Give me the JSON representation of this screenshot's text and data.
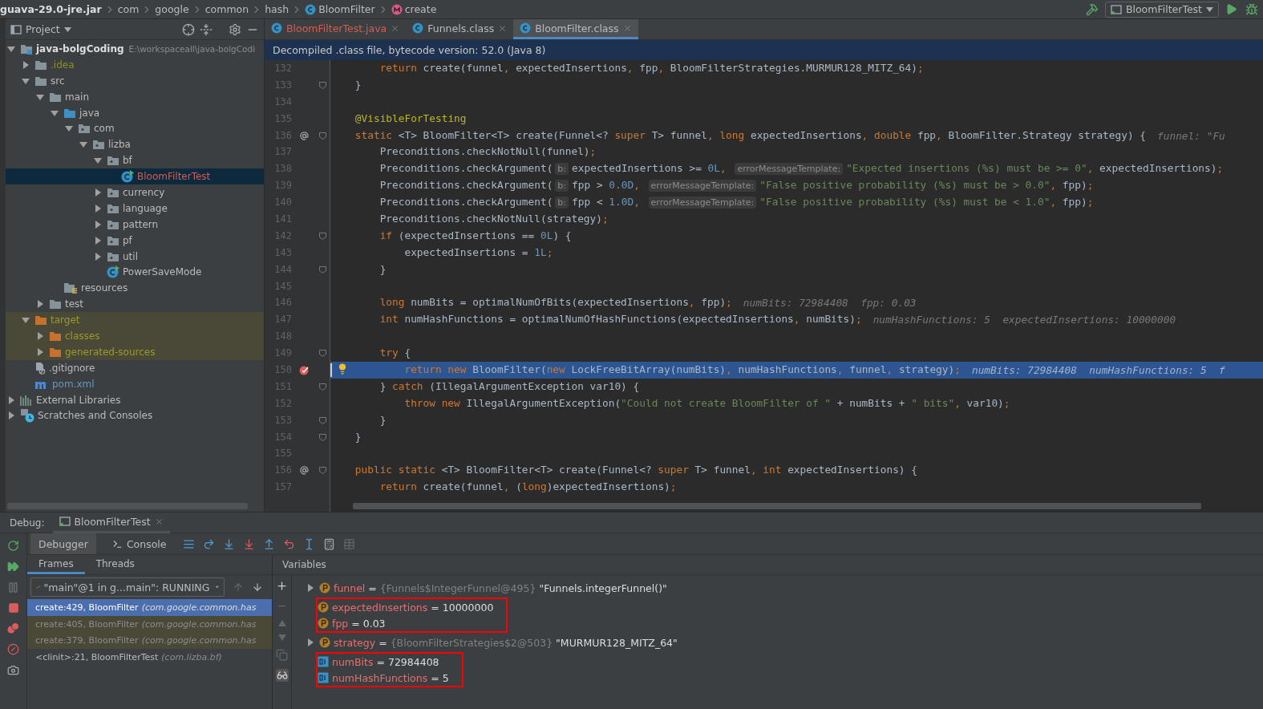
{
  "breadcrumbs": [
    {
      "label": "guava-29.0-jre.jar",
      "kind": "archive"
    },
    {
      "label": "com",
      "kind": "package"
    },
    {
      "label": "google",
      "kind": "package"
    },
    {
      "label": "common",
      "kind": "package"
    },
    {
      "label": "hash",
      "kind": "package"
    },
    {
      "label": "BloomFilter",
      "kind": "class"
    },
    {
      "label": "create",
      "kind": "method"
    }
  ],
  "run_config": {
    "label": "BloomFilterTest"
  },
  "project": {
    "title": "Project",
    "tree": [
      {
        "label": "java-bolgCoding",
        "path": "E:\\workspaceall\\java-bolgCodi",
        "kind": "module",
        "color": "#dddddd",
        "expanded": true,
        "selected": false,
        "children": [
          {
            "label": ".idea",
            "kind": "folder",
            "color": "#8f8f25",
            "expanded": false,
            "selected": false
          },
          {
            "label": "src",
            "kind": "folder",
            "color": "#bbbbbb",
            "expanded": true,
            "selected": false,
            "children": [
              {
                "label": "main",
                "kind": "folder",
                "color": "#bbbbbb",
                "expanded": true,
                "selected": false,
                "children": [
                  {
                    "label": "java",
                    "kind": "source",
                    "color": "#bbbbbb",
                    "expanded": true,
                    "selected": false,
                    "children": [
                      {
                        "label": "com",
                        "kind": "package",
                        "color": "#bbbbbb",
                        "expanded": true,
                        "selected": false,
                        "children": [
                          {
                            "label": "lizba",
                            "kind": "package",
                            "color": "#bbbbbb",
                            "expanded": true,
                            "selected": false,
                            "children": [
                              {
                                "label": "bf",
                                "kind": "package",
                                "color": "#bbbbbb",
                                "expanded": true,
                                "selected": false,
                                "children": [
                                  {
                                    "label": "BloomFilterTest",
                                    "kind": "class",
                                    "color": "#d55c52",
                                    "selected": true
                                  }
                                ]
                              },
                              {
                                "label": "currency",
                                "kind": "package",
                                "color": "#bbbbbb",
                                "expanded": false,
                                "selected": false
                              },
                              {
                                "label": "language",
                                "kind": "package",
                                "color": "#bbbbbb",
                                "expanded": false,
                                "selected": false
                              },
                              {
                                "label": "pattern",
                                "kind": "package",
                                "color": "#bbbbbb",
                                "expanded": false,
                                "selected": false
                              },
                              {
                                "label": "pf",
                                "kind": "package",
                                "color": "#bbbbbb",
                                "expanded": false,
                                "selected": false
                              },
                              {
                                "label": "util",
                                "kind": "package",
                                "color": "#bbbbbb",
                                "expanded": false,
                                "selected": false
                              },
                              {
                                "label": "PowerSaveMode",
                                "kind": "class",
                                "color": "#bbbbbb",
                                "selected": false
                              }
                            ]
                          }
                        ]
                      }
                    ]
                  },
                  {
                    "label": "resources",
                    "kind": "resources",
                    "color": "#bbbbbb",
                    "selected": false
                  }
                ]
              },
              {
                "label": "test",
                "kind": "folder",
                "color": "#bbbbbb",
                "expanded": false,
                "selected": false
              }
            ]
          },
          {
            "label": "target",
            "kind": "excluded",
            "color": "#9a9a2a",
            "expanded": true,
            "selected": false,
            "children": [
              {
                "label": "classes",
                "kind": "excluded",
                "color": "#9a9a2a",
                "expanded": false,
                "selected": false
              },
              {
                "label": "generated-sources",
                "kind": "excluded",
                "color": "#9a9a2a",
                "expanded": false,
                "selected": false
              }
            ]
          },
          {
            "label": ".gitignore",
            "kind": "gitignore",
            "color": "#bbbbbb",
            "selected": false
          },
          {
            "label": "pom.xml",
            "kind": "maven",
            "color": "#6897bb",
            "selected": false
          }
        ]
      },
      {
        "label": "External Libraries",
        "kind": "libraries",
        "color": "#bbbbbb",
        "expanded": false,
        "selected": false
      },
      {
        "label": "Scratches and Consoles",
        "kind": "scratches",
        "color": "#bbbbbb",
        "expanded": false,
        "selected": false
      }
    ]
  },
  "editor": {
    "tabs": [
      {
        "label": "BloomFilterTest.java",
        "color": "#d55c52",
        "selected": false
      },
      {
        "label": "Funnels.class",
        "color": "#bbbbbb",
        "selected": false
      },
      {
        "label": "BloomFilter.class",
        "color": "#bbbbbb",
        "selected": true
      }
    ],
    "banner": "Decompiled .class file, bytecode version: 52.0 (Java 8)",
    "lines": [
      {
        "number": "132",
        "selected": false,
        "code": [
          {
            "kind": "keyword",
            "text": "        return "
          },
          {
            "kind": "plain",
            "text": "create(funnel"
          },
          {
            "kind": "keyword",
            "text": ", "
          },
          {
            "kind": "plain",
            "text": "expectedInsertions"
          },
          {
            "kind": "keyword",
            "text": ", "
          },
          {
            "kind": "plain",
            "text": "fpp"
          },
          {
            "kind": "keyword",
            "text": ", "
          },
          {
            "kind": "plain",
            "text": "BloomFilterStrategies.MURMUR128_MITZ_64)"
          },
          {
            "kind": "keyword",
            "text": ";"
          }
        ]
      },
      {
        "number": "133",
        "selected": false,
        "fold": true,
        "code": [
          {
            "kind": "plain",
            "text": "    }"
          }
        ]
      },
      {
        "number": "134",
        "selected": false
      },
      {
        "number": "135",
        "selected": false,
        "code": [
          {
            "kind": "annotation",
            "text": "    @VisibleForTesting"
          }
        ]
      },
      {
        "number": "136",
        "selected": false,
        "fold": true,
        "marker": {
          "kind": "override"
        },
        "code": [
          {
            "kind": "keyword",
            "text": "    static "
          },
          {
            "kind": "plain",
            "text": "<T> BloomFilter<T> create(Funnel<? "
          },
          {
            "kind": "keyword",
            "text": "super "
          },
          {
            "kind": "plain",
            "text": "T> funnel"
          },
          {
            "kind": "keyword",
            "text": ", long "
          },
          {
            "kind": "plain",
            "text": "expectedInsertions"
          },
          {
            "kind": "keyword",
            "text": ", double "
          },
          {
            "kind": "plain",
            "text": "fpp"
          },
          {
            "kind": "keyword",
            "text": ", "
          },
          {
            "kind": "plain",
            "text": "BloomFilter.Strategy strategy) {"
          }
        ],
        "hint": "funnel: \"Fu"
      },
      {
        "number": "137",
        "selected": false,
        "code": [
          {
            "kind": "plain",
            "text": "        Preconditions.checkNotNull(funnel)"
          },
          {
            "kind": "keyword",
            "text": ";"
          }
        ]
      },
      {
        "number": "138",
        "selected": false,
        "code": [
          {
            "kind": "plain",
            "text": "        Preconditions.checkArgument("
          },
          {
            "kind": "hint",
            "text": "b:"
          },
          {
            "kind": "plain",
            "text": "expectedInsertions >= "
          },
          {
            "kind": "number",
            "text": "0L"
          },
          {
            "kind": "keyword",
            "text": ", "
          },
          {
            "kind": "hint",
            "text": "errorMessageTemplate:"
          },
          {
            "kind": "string",
            "text": "\"Expected insertions (%s) must be >= 0\""
          },
          {
            "kind": "keyword",
            "text": ", "
          },
          {
            "kind": "plain",
            "text": "expectedInsertions)"
          },
          {
            "kind": "keyword",
            "text": ";"
          }
        ]
      },
      {
        "number": "139",
        "selected": false,
        "code": [
          {
            "kind": "plain",
            "text": "        Preconditions.checkArgument("
          },
          {
            "kind": "hint",
            "text": "b:"
          },
          {
            "kind": "plain",
            "text": "fpp > "
          },
          {
            "kind": "number",
            "text": "0.0D"
          },
          {
            "kind": "keyword",
            "text": ", "
          },
          {
            "kind": "hint",
            "text": "errorMessageTemplate:"
          },
          {
            "kind": "string",
            "text": "\"False positive probability (%s) must be > 0.0\""
          },
          {
            "kind": "keyword",
            "text": ", "
          },
          {
            "kind": "plain",
            "text": "fpp)"
          },
          {
            "kind": "keyword",
            "text": ";"
          }
        ]
      },
      {
        "number": "140",
        "selected": false,
        "code": [
          {
            "kind": "plain",
            "text": "        Preconditions.checkArgument("
          },
          {
            "kind": "hint",
            "text": "b:"
          },
          {
            "kind": "plain",
            "text": "fpp < "
          },
          {
            "kind": "number",
            "text": "1.0D"
          },
          {
            "kind": "keyword",
            "text": ", "
          },
          {
            "kind": "hint",
            "text": "errorMessageTemplate:"
          },
          {
            "kind": "string",
            "text": "\"False positive probability (%s) must be < 1.0\""
          },
          {
            "kind": "keyword",
            "text": ", "
          },
          {
            "kind": "plain",
            "text": "fpp)"
          },
          {
            "kind": "keyword",
            "text": ";"
          }
        ]
      },
      {
        "number": "141",
        "selected": false,
        "code": [
          {
            "kind": "plain",
            "text": "        Preconditions.checkNotNull(strategy)"
          },
          {
            "kind": "keyword",
            "text": ";"
          }
        ]
      },
      {
        "number": "142",
        "selected": false,
        "fold": true,
        "code": [
          {
            "kind": "keyword",
            "text": "        if "
          },
          {
            "kind": "plain",
            "text": "(expectedInsertions == "
          },
          {
            "kind": "number",
            "text": "0L"
          },
          {
            "kind": "plain",
            "text": ") {"
          }
        ]
      },
      {
        "number": "143",
        "selected": false,
        "code": [
          {
            "kind": "plain",
            "text": "            expectedInsertions = "
          },
          {
            "kind": "number",
            "text": "1L"
          },
          {
            "kind": "keyword",
            "text": ";"
          }
        ]
      },
      {
        "number": "144",
        "selected": false,
        "fold": true,
        "code": [
          {
            "kind": "plain",
            "text": "        }"
          }
        ]
      },
      {
        "number": "145",
        "selected": false
      },
      {
        "number": "146",
        "selected": false,
        "code": [
          {
            "kind": "keyword",
            "text": "        long "
          },
          {
            "kind": "plain",
            "text": "numBits = optimalNumOfBits(expectedInsertions"
          },
          {
            "kind": "keyword",
            "text": ", "
          },
          {
            "kind": "plain",
            "text": "fpp)"
          },
          {
            "kind": "keyword",
            "text": ";"
          }
        ],
        "hint": "numBits: 72984408  fpp: 0.03"
      },
      {
        "number": "147",
        "selected": false,
        "code": [
          {
            "kind": "keyword",
            "text": "        int "
          },
          {
            "kind": "plain",
            "text": "numHashFunctions = optimalNumOfHashFunctions(expectedInsertions"
          },
          {
            "kind": "keyword",
            "text": ", "
          },
          {
            "kind": "plain",
            "text": "numBits)"
          },
          {
            "kind": "keyword",
            "text": ";"
          }
        ],
        "hint": "numHashFunctions: 5  expectedInsertions: 10000000"
      },
      {
        "number": "148",
        "selected": false
      },
      {
        "number": "149",
        "selected": false,
        "fold": true,
        "code": [
          {
            "kind": "keyword",
            "text": "        try "
          },
          {
            "kind": "plain",
            "text": "{"
          }
        ]
      },
      {
        "number": "150",
        "selected": true,
        "marker": {
          "kind": "breakpoint"
        },
        "code": [
          {
            "kind": "keyword",
            "text": "            return new "
          },
          {
            "kind": "plain",
            "text": "BloomFilter("
          },
          {
            "kind": "keyword",
            "text": "new "
          },
          {
            "kind": "plain",
            "text": "LockFreeBitArray(numBits)"
          },
          {
            "kind": "keyword",
            "text": ", "
          },
          {
            "kind": "plain",
            "text": "numHashFunctions"
          },
          {
            "kind": "keyword",
            "text": ", "
          },
          {
            "kind": "plain",
            "text": "funnel"
          },
          {
            "kind": "keyword",
            "text": ", "
          },
          {
            "kind": "plain",
            "text": "strategy)"
          },
          {
            "kind": "keyword",
            "text": ";"
          }
        ],
        "hint": "numBits: 72984408  numHashFunctions: 5  f"
      },
      {
        "number": "151",
        "selected": false,
        "fold": true,
        "code": [
          {
            "kind": "plain",
            "text": "        } "
          },
          {
            "kind": "keyword",
            "text": "catch "
          },
          {
            "kind": "plain",
            "text": "(IllegalArgumentException var10) {"
          }
        ]
      },
      {
        "number": "152",
        "selected": false,
        "code": [
          {
            "kind": "keyword",
            "text": "            throw new "
          },
          {
            "kind": "plain",
            "text": "IllegalArgumentException("
          },
          {
            "kind": "string",
            "text": "\"Could not create BloomFilter of \""
          },
          {
            "kind": "plain",
            "text": " + numBits + "
          },
          {
            "kind": "string",
            "text": "\" bits\""
          },
          {
            "kind": "keyword",
            "text": ", "
          },
          {
            "kind": "plain",
            "text": "var10)"
          },
          {
            "kind": "keyword",
            "text": ";"
          }
        ]
      },
      {
        "number": "153",
        "selected": false,
        "fold": true,
        "code": [
          {
            "kind": "plain",
            "text": "        }"
          }
        ]
      },
      {
        "number": "154",
        "selected": false,
        "fold": true,
        "code": [
          {
            "kind": "plain",
            "text": "    }"
          }
        ]
      },
      {
        "number": "155",
        "selected": false
      },
      {
        "number": "156",
        "selected": false,
        "fold": true,
        "marker": {
          "kind": "override"
        },
        "code": [
          {
            "kind": "keyword",
            "text": "    public static "
          },
          {
            "kind": "plain",
            "text": "<T> BloomFilter<T> create(Funnel<? "
          },
          {
            "kind": "keyword",
            "text": "super "
          },
          {
            "kind": "plain",
            "text": "T> funnel"
          },
          {
            "kind": "keyword",
            "text": ", int "
          },
          {
            "kind": "plain",
            "text": "expectedInsertions) {"
          }
        ]
      },
      {
        "number": "157",
        "selected": false,
        "code": [
          {
            "kind": "keyword",
            "text": "        return "
          },
          {
            "kind": "plain",
            "text": "create(funnel"
          },
          {
            "kind": "keyword",
            "text": ", "
          },
          {
            "kind": "plain",
            "text": "("
          },
          {
            "kind": "keyword",
            "text": "long"
          },
          {
            "kind": "plain",
            "text": ")expectedInsertions)"
          },
          {
            "kind": "keyword",
            "text": ";"
          }
        ]
      }
    ]
  },
  "debug": {
    "title": "Debug:",
    "session_tab": "BloomFilterTest",
    "tabs": [
      {
        "label": "Debugger",
        "selected": true,
        "kind": "plain"
      },
      {
        "label": "Console",
        "selected": false,
        "kind": "console"
      }
    ],
    "frames_tabs": [
      {
        "label": "Frames",
        "selected": true
      },
      {
        "label": "Threads",
        "selected": false
      }
    ],
    "thread": "\"main\"@1 in g...main\": RUNNING",
    "frames": [
      {
        "label": "create:429, BloomFilter",
        "package": "(com.google.common.has",
        "kind": "library",
        "selected": true
      },
      {
        "label": "create:405, BloomFilter",
        "package": "(com.google.common.has",
        "kind": "library",
        "selected": false
      },
      {
        "label": "create:379, BloomFilter",
        "package": "(com.google.common.has",
        "kind": "library",
        "selected": false
      },
      {
        "label": "<clinit>:21, BloomFilterTest",
        "package": "(com.lizba.bf)",
        "kind": "user",
        "selected": false
      }
    ],
    "variables": {
      "title": "Variables",
      "groups": [
        {
          "boxed": false,
          "items": [
            {
              "name": "funnel",
              "value": "=",
              "type": "{Funnels$IntegerFunnel@495}",
              "detail": "\"Funnels.integerFunnel()\"",
              "kind": "param",
              "expanded": false
            }
          ]
        },
        {
          "boxed": true,
          "items": [
            {
              "name": "expectedInsertions",
              "value": "= 10000000",
              "kind": "param"
            },
            {
              "name": "fpp",
              "value": "= 0.03",
              "kind": "param"
            }
          ]
        },
        {
          "boxed": false,
          "items": [
            {
              "name": "strategy",
              "value": "=",
              "type": "{BloomFilterStrategies$2@503}",
              "detail": "\"MURMUR128_MITZ_64\"",
              "kind": "param",
              "expanded": false
            }
          ]
        },
        {
          "boxed": true,
          "items": [
            {
              "name": "numBits",
              "value": "= 72984408",
              "kind": "local"
            },
            {
              "name": "numHashFunctions",
              "value": "= 5",
              "kind": "local"
            }
          ]
        }
      ]
    }
  }
}
